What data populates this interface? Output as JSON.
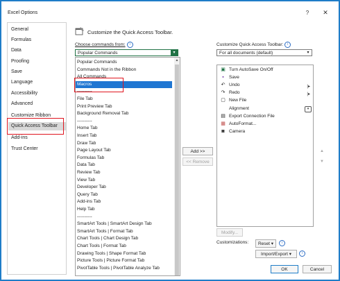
{
  "window": {
    "title": "Excel Options",
    "help": "?",
    "close": "✕"
  },
  "sidebar": {
    "items": [
      {
        "label": "General"
      },
      {
        "label": "Formulas"
      },
      {
        "label": "Data"
      },
      {
        "label": "Proofing"
      },
      {
        "label": "Save"
      },
      {
        "label": "Language"
      },
      {
        "label": "Accessibility"
      },
      {
        "label": "Advanced"
      },
      {
        "label": "Customize Ribbon"
      },
      {
        "label": "Quick Access Toolbar",
        "selected": true
      },
      {
        "label": "Add-ins"
      },
      {
        "label": "Trust Center"
      }
    ]
  },
  "header": {
    "text": "Customize the Quick Access Toolbar.",
    "icon": "qat-customize-icon"
  },
  "left": {
    "choose_label": "Choose commands from:",
    "choose_value": "Popular Commands",
    "list": [
      "Popular Commands",
      "Commands Not in the Ribbon",
      "All Commands",
      "Macros",
      "----------",
      "File Tab",
      "Print Preview Tab",
      "Background Removal Tab",
      "----------",
      "Home Tab",
      "Insert Tab",
      "Draw Tab",
      "Page Layout Tab",
      "Formulas Tab",
      "Data Tab",
      "Review Tab",
      "View Tab",
      "Developer Tab",
      "Query Tab",
      "Add-ins Tab",
      "Help Tab",
      "----------",
      "SmartArt Tools | SmartArt Design Tab",
      "SmartArt Tools | Format Tab",
      "Chart Tools | Chart Design Tab",
      "Chart Tools | Format Tab",
      "Drawing Tools | Shape Format Tab",
      "Picture Tools | Picture Format Tab",
      "PivotTable Tools | PivotTable Analyze Tab"
    ],
    "selected_index": 3
  },
  "middle": {
    "add": "Add >>",
    "remove": "<< Remove"
  },
  "right": {
    "customize_label": "Customize Quick Access Toolbar:",
    "customize_value": "For all documents (default)",
    "items": [
      {
        "label": "Turn AutoSave On/Off",
        "icon": "autosave-icon"
      },
      {
        "label": "Save",
        "icon": "save-icon"
      },
      {
        "label": "Undo",
        "icon": "undo-icon"
      },
      {
        "label": "Redo",
        "icon": "redo-icon"
      },
      {
        "label": "New File",
        "icon": "new-file-icon"
      },
      {
        "label": "Alignment",
        "icon": ""
      },
      {
        "label": "Export Connection File",
        "icon": "export-connection-icon"
      },
      {
        "label": "AutoFormat...",
        "icon": "autoformat-icon"
      },
      {
        "label": "Camera",
        "icon": "camera-icon"
      }
    ],
    "modify": "Modify...",
    "customizations_label": "Customizations:",
    "reset": "Reset ▾",
    "import_export": "Import/Export ▾"
  },
  "footer": {
    "ok": "OK",
    "cancel": "Cancel"
  },
  "colors": {
    "accent": "#1f7dc8",
    "selection": "#1f76d2",
    "highlight": "#e0141e",
    "excel_green": "#217346"
  }
}
